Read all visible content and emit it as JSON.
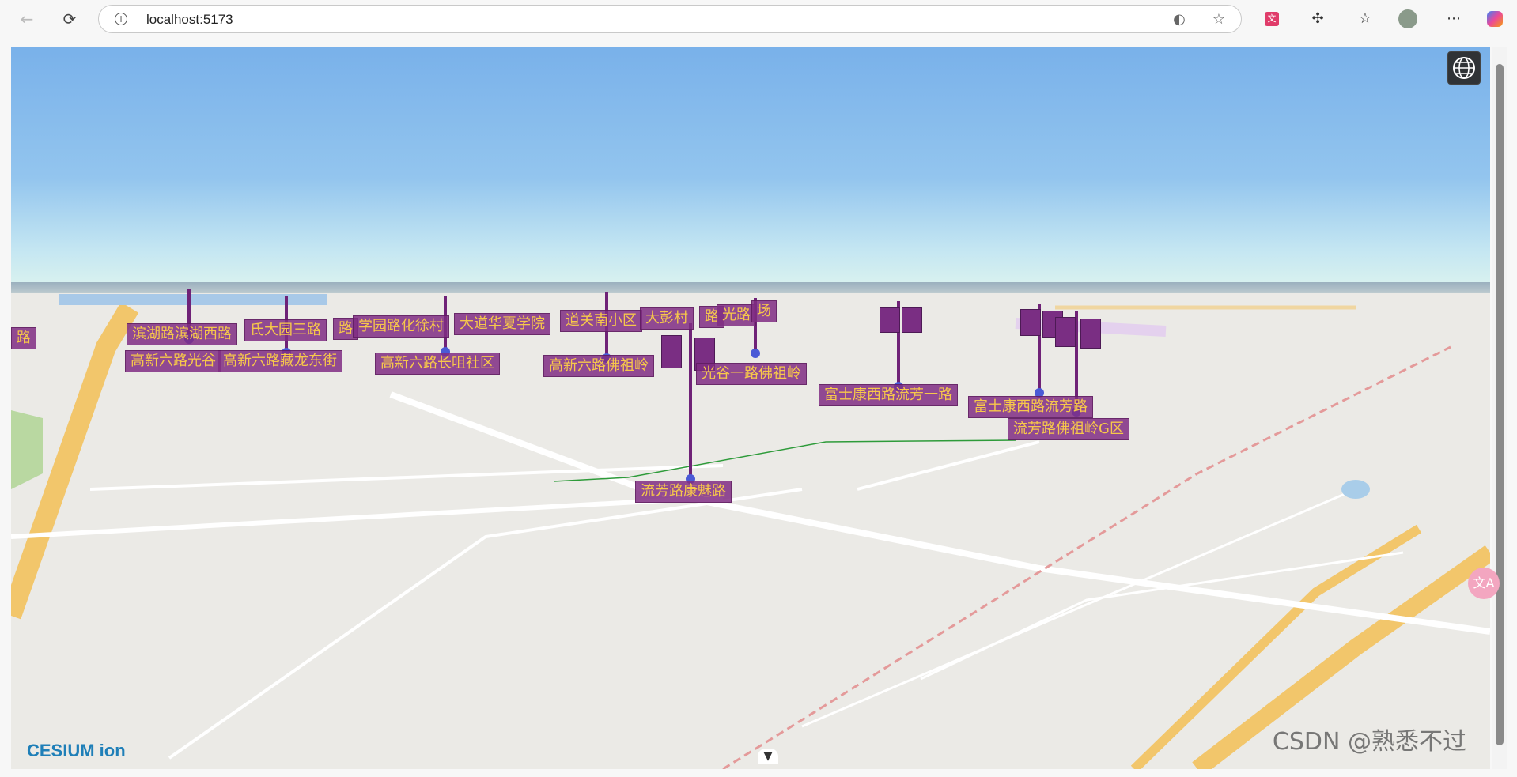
{
  "browser": {
    "url": "localhost:5173",
    "back_icon": "back-arrow-icon",
    "reload_icon": "reload-icon"
  },
  "map": {
    "labels": [
      {
        "text": "路"
      },
      {
        "text": "滨湖路滨湖西路"
      },
      {
        "text": "氏大园三路"
      },
      {
        "text": "路"
      },
      {
        "text": "学园路化徐村"
      },
      {
        "text": "大道华夏学院"
      },
      {
        "text": "道关南小区"
      },
      {
        "text": "大彭村"
      },
      {
        "text": "路"
      },
      {
        "text": "光路"
      },
      {
        "text": "场"
      },
      {
        "text": "高新六路光谷"
      },
      {
        "text": "高新六路藏龙东街"
      },
      {
        "text": "高新六路长咀社区"
      },
      {
        "text": "高新六路佛祖岭"
      },
      {
        "text": "光谷一路佛祖岭"
      },
      {
        "text": "富士康西路流芳一路"
      },
      {
        "text": "富士康西路流芳路"
      },
      {
        "text": "流芳路佛祖岭G区"
      },
      {
        "text": "流芳路康魅路"
      }
    ],
    "colors": {
      "label_bg": "#802d82",
      "label_text": "#f7c84a",
      "sky_top": "#79b1ea",
      "route_line": "#2e9b3a"
    },
    "attribution": "CESIUM ion",
    "watermark": "CSDN @熟悉不过"
  },
  "icons": {
    "globe": "globe-icon",
    "collapse": "chevron-down-icon",
    "translate": "translate-icon"
  }
}
